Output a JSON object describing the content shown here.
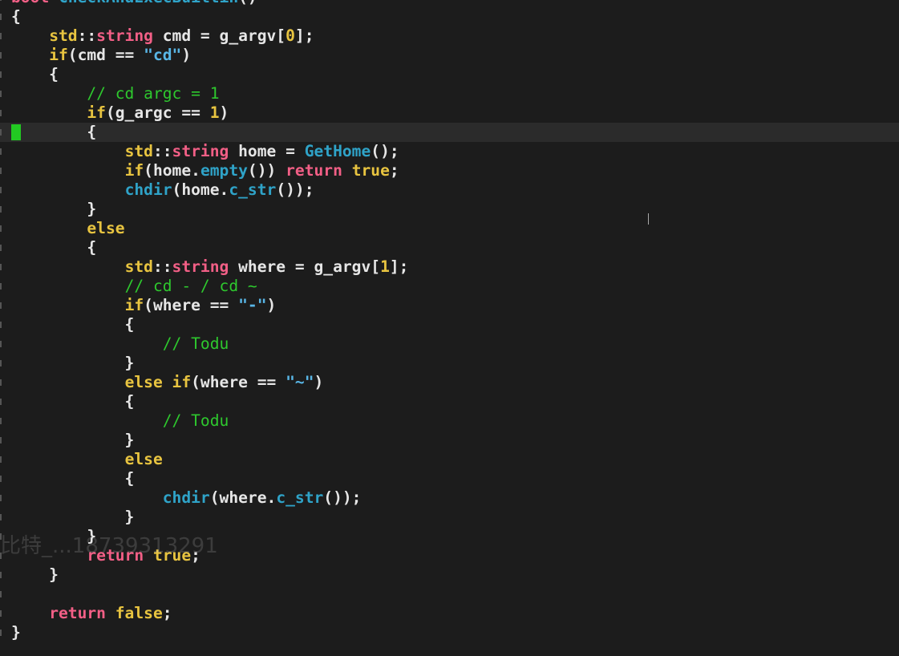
{
  "editor": {
    "lines": [
      [
        {
          "t": "bool ",
          "c": "rd"
        },
        {
          "t": "CheckAndExecBuiltin",
          "c": "cy"
        },
        {
          "t": "()",
          "c": "ws"
        }
      ],
      [
        {
          "t": "{",
          "c": "ws"
        }
      ],
      [
        {
          "t": "    ",
          "c": "ws"
        },
        {
          "t": "std",
          "c": "kw"
        },
        {
          "t": "::",
          "c": "ws"
        },
        {
          "t": "string",
          "c": "rd"
        },
        {
          "t": " cmd = g_argv[",
          "c": "ws"
        },
        {
          "t": "0",
          "c": "nm"
        },
        {
          "t": "];",
          "c": "ws"
        }
      ],
      [
        {
          "t": "    ",
          "c": "ws"
        },
        {
          "t": "if",
          "c": "kw"
        },
        {
          "t": "(cmd == ",
          "c": "ws"
        },
        {
          "t": "\"cd\"",
          "c": "st"
        },
        {
          "t": ")",
          "c": "ws"
        }
      ],
      [
        {
          "t": "    {",
          "c": "ws"
        }
      ],
      [
        {
          "t": "        ",
          "c": "ws"
        },
        {
          "t": "// cd argc = 1",
          "c": "cm"
        }
      ],
      [
        {
          "t": "        ",
          "c": "ws"
        },
        {
          "t": "if",
          "c": "kw"
        },
        {
          "t": "(g_argc == ",
          "c": "ws"
        },
        {
          "t": "1",
          "c": "nm"
        },
        {
          "t": ")",
          "c": "ws"
        }
      ],
      [
        {
          "t": "        {",
          "c": "ws"
        }
      ],
      [
        {
          "t": "            ",
          "c": "ws"
        },
        {
          "t": "std",
          "c": "kw"
        },
        {
          "t": "::",
          "c": "ws"
        },
        {
          "t": "string",
          "c": "rd"
        },
        {
          "t": " home = ",
          "c": "ws"
        },
        {
          "t": "GetHome",
          "c": "cy"
        },
        {
          "t": "();",
          "c": "ws"
        }
      ],
      [
        {
          "t": "            ",
          "c": "ws"
        },
        {
          "t": "if",
          "c": "kw"
        },
        {
          "t": "(home.",
          "c": "ws"
        },
        {
          "t": "empty",
          "c": "cy"
        },
        {
          "t": "()) ",
          "c": "ws"
        },
        {
          "t": "return",
          "c": "rd"
        },
        {
          "t": " ",
          "c": "ws"
        },
        {
          "t": "true",
          "c": "kw"
        },
        {
          "t": ";",
          "c": "ws"
        }
      ],
      [
        {
          "t": "            ",
          "c": "ws"
        },
        {
          "t": "chdir",
          "c": "cy"
        },
        {
          "t": "(home.",
          "c": "ws"
        },
        {
          "t": "c_str",
          "c": "cy"
        },
        {
          "t": "());",
          "c": "ws"
        }
      ],
      [
        {
          "t": "        }",
          "c": "ws"
        }
      ],
      [
        {
          "t": "        ",
          "c": "ws"
        },
        {
          "t": "else",
          "c": "kw"
        }
      ],
      [
        {
          "t": "        {",
          "c": "ws"
        }
      ],
      [
        {
          "t": "            ",
          "c": "ws"
        },
        {
          "t": "std",
          "c": "kw"
        },
        {
          "t": "::",
          "c": "ws"
        },
        {
          "t": "string",
          "c": "rd"
        },
        {
          "t": " where = g_argv[",
          "c": "ws"
        },
        {
          "t": "1",
          "c": "nm"
        },
        {
          "t": "];",
          "c": "ws"
        }
      ],
      [
        {
          "t": "            ",
          "c": "ws"
        },
        {
          "t": "// cd - / cd ~",
          "c": "cm"
        }
      ],
      [
        {
          "t": "            ",
          "c": "ws"
        },
        {
          "t": "if",
          "c": "kw"
        },
        {
          "t": "(where == ",
          "c": "ws"
        },
        {
          "t": "\"-\"",
          "c": "st"
        },
        {
          "t": ")",
          "c": "ws"
        }
      ],
      [
        {
          "t": "            {",
          "c": "ws"
        }
      ],
      [
        {
          "t": "                ",
          "c": "ws"
        },
        {
          "t": "// Todu",
          "c": "cm"
        }
      ],
      [
        {
          "t": "            }",
          "c": "ws"
        }
      ],
      [
        {
          "t": "            ",
          "c": "ws"
        },
        {
          "t": "else",
          "c": "kw"
        },
        {
          "t": " ",
          "c": "ws"
        },
        {
          "t": "if",
          "c": "kw"
        },
        {
          "t": "(where == ",
          "c": "ws"
        },
        {
          "t": "\"~\"",
          "c": "st"
        },
        {
          "t": ")",
          "c": "ws"
        }
      ],
      [
        {
          "t": "            {",
          "c": "ws"
        }
      ],
      [
        {
          "t": "                ",
          "c": "ws"
        },
        {
          "t": "// Todu",
          "c": "cm"
        }
      ],
      [
        {
          "t": "            }",
          "c": "ws"
        }
      ],
      [
        {
          "t": "            ",
          "c": "ws"
        },
        {
          "t": "else",
          "c": "kw"
        }
      ],
      [
        {
          "t": "            {",
          "c": "ws"
        }
      ],
      [
        {
          "t": "                ",
          "c": "ws"
        },
        {
          "t": "chdir",
          "c": "cy"
        },
        {
          "t": "(where.",
          "c": "ws"
        },
        {
          "t": "c_str",
          "c": "cy"
        },
        {
          "t": "());",
          "c": "ws"
        }
      ],
      [
        {
          "t": "            }",
          "c": "ws"
        }
      ],
      [
        {
          "t": "        }",
          "c": "ws"
        }
      ],
      [
        {
          "t": "        ",
          "c": "ws"
        },
        {
          "t": "return",
          "c": "rd"
        },
        {
          "t": " ",
          "c": "ws"
        },
        {
          "t": "true",
          "c": "kw"
        },
        {
          "t": ";",
          "c": "ws"
        }
      ],
      [
        {
          "t": "    }",
          "c": "ws"
        }
      ],
      [
        {
          "t": "",
          "c": "ws"
        }
      ],
      [
        {
          "t": "    ",
          "c": "ws"
        },
        {
          "t": "return",
          "c": "rd"
        },
        {
          "t": " ",
          "c": "ws"
        },
        {
          "t": "false",
          "c": "kw"
        },
        {
          "t": ";",
          "c": "ws"
        }
      ],
      [
        {
          "t": "}",
          "c": "ws"
        }
      ]
    ],
    "cursor_line": 7,
    "watermark": "比特_...18739313291",
    "colors": {
      "background": "#1c1c1c",
      "cursorline": "#2b2b2b",
      "cursor": "#22c922",
      "keyword_yellow": "#e8c440",
      "keyword_red": "#f25f86",
      "function_cyan": "#2fa3c8",
      "comment_green": "#2ec92e",
      "string_blue": "#59b6e6",
      "text": "#e6e6e6"
    }
  }
}
